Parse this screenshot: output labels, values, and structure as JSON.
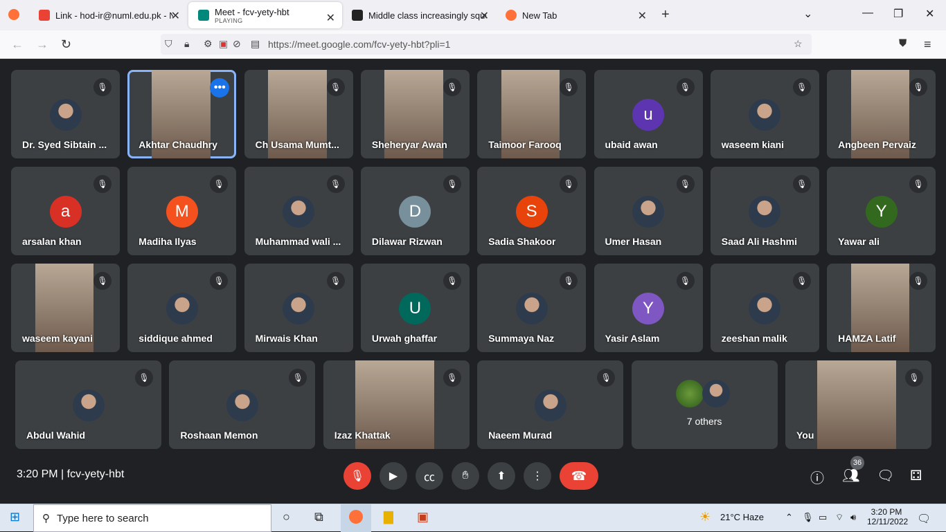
{
  "browser": {
    "tabs": [
      {
        "title": "Link - hod-ir@numl.edu.pk - Na",
        "icon": "gmail-icon",
        "color": "#ea4335"
      },
      {
        "title": "Meet - fcv-yety-hbt",
        "sub": "PLAYING",
        "icon": "meet-icon",
        "color": "#00897b",
        "active": true
      },
      {
        "title": "Middle class increasingly squee",
        "icon": "news-icon",
        "color": "#222"
      },
      {
        "title": "New Tab",
        "icon": "firefox-icon",
        "color": "#ff7139"
      }
    ],
    "url": "https://meet.google.com/fcv-yety-hbt?pli=1"
  },
  "participants": [
    {
      "name": "Dr. Syed Sibtain ...",
      "kind": "photo"
    },
    {
      "name": "Akhtar Chaudhry",
      "kind": "video",
      "speaking": true
    },
    {
      "name": "Ch Usama Mumt...",
      "kind": "video"
    },
    {
      "name": "Sheheryar Awan",
      "kind": "video"
    },
    {
      "name": "Taimoor Farooq",
      "kind": "video"
    },
    {
      "name": "ubaid awan",
      "kind": "letter",
      "letter": "u",
      "color": "#5e35b1"
    },
    {
      "name": "waseem kiani",
      "kind": "photo"
    },
    {
      "name": "Angbeen Pervaiz",
      "kind": "video"
    },
    {
      "name": "arsalan khan",
      "kind": "letter",
      "letter": "a",
      "color": "#d93025"
    },
    {
      "name": "Madiha Ilyas",
      "kind": "letter",
      "letter": "M",
      "color": "#f4511e"
    },
    {
      "name": "Muhammad wali ...",
      "kind": "photo"
    },
    {
      "name": "Dilawar Rizwan",
      "kind": "letter",
      "letter": "D",
      "color": "#78909c"
    },
    {
      "name": "Sadia Shakoor",
      "kind": "letter",
      "letter": "S",
      "color": "#e8430a"
    },
    {
      "name": "Umer Hasan",
      "kind": "photo"
    },
    {
      "name": "Saad Ali Hashmi",
      "kind": "photo"
    },
    {
      "name": "Yawar ali",
      "kind": "letter",
      "letter": "Y",
      "color": "#33691e"
    },
    {
      "name": "waseem kayani",
      "kind": "video"
    },
    {
      "name": "siddique ahmed",
      "kind": "photo"
    },
    {
      "name": "Mirwais Khan",
      "kind": "photo"
    },
    {
      "name": "Urwah ghaffar",
      "kind": "letter",
      "letter": "U",
      "color": "#00695c"
    },
    {
      "name": "Summaya Naz",
      "kind": "photo"
    },
    {
      "name": "Yasir Aslam",
      "kind": "letter",
      "letter": "Y",
      "color": "#7e57c2"
    },
    {
      "name": "zeeshan malik",
      "kind": "photo"
    },
    {
      "name": "HAMZA Latif",
      "kind": "video"
    },
    {
      "name": "Abdul Wahid",
      "kind": "photo"
    },
    {
      "name": "Roshaan Memon",
      "kind": "photo"
    },
    {
      "name": "Izaz Khattak",
      "kind": "video"
    },
    {
      "name": "Naeem Murad",
      "kind": "photo"
    },
    {
      "name": "7 others",
      "kind": "others"
    },
    {
      "name": "You",
      "kind": "video"
    }
  ],
  "bottom": {
    "time": "3:20 PM",
    "code": "fcv-yety-hbt",
    "people_count": "36"
  },
  "taskbar": {
    "search_placeholder": "Type here to search",
    "weather": "21°C  Haze",
    "time": "3:20 PM",
    "date": "12/11/2022"
  }
}
